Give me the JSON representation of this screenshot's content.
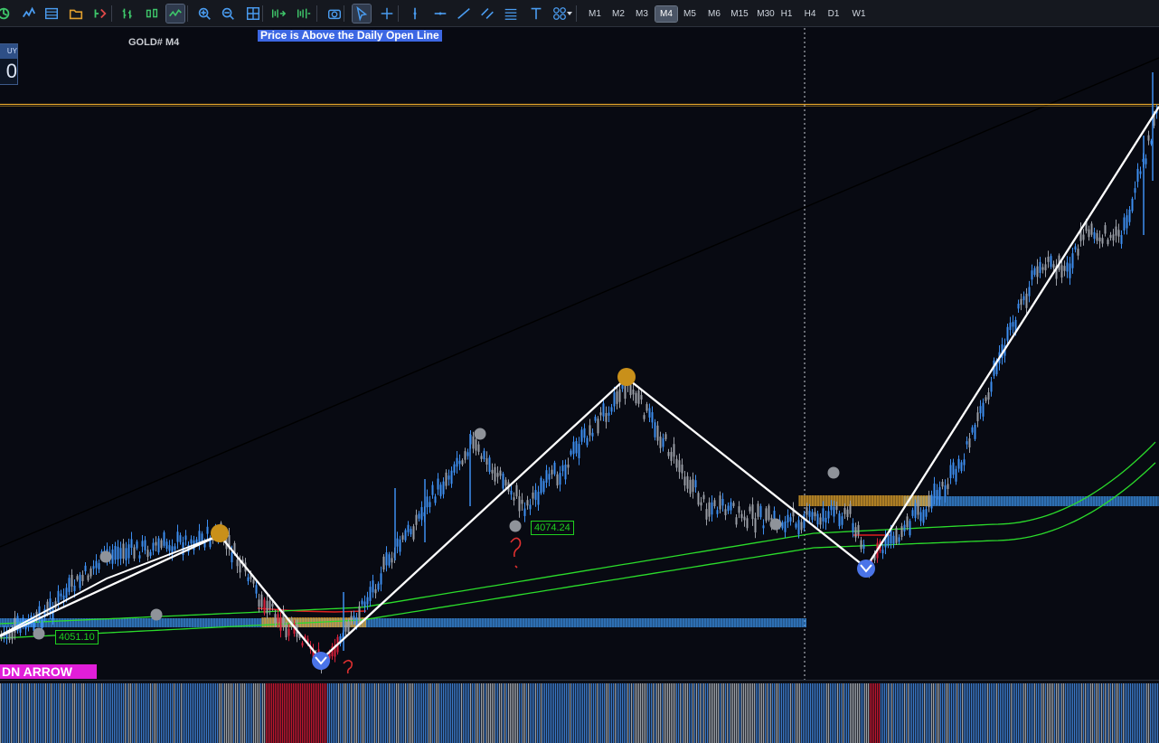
{
  "toolbar": {
    "tools": [
      {
        "name": "auto-trading-icon",
        "label": "Algo Trading"
      },
      {
        "name": "signals-icon",
        "label": "Signals"
      },
      {
        "name": "market-watch-icon",
        "label": "Market Watch"
      },
      {
        "name": "folder-icon",
        "label": "Data Folder"
      },
      {
        "name": "new-order-icon",
        "label": "New Order"
      },
      {
        "name": "bar-chart-icon",
        "label": "Bar Chart"
      },
      {
        "name": "candlestick-icon",
        "label": "Candlesticks"
      },
      {
        "name": "line-chart-icon",
        "label": "Line Chart"
      },
      {
        "name": "zoom-in-icon",
        "label": "Zoom In"
      },
      {
        "name": "zoom-out-icon",
        "label": "Zoom Out"
      },
      {
        "name": "grid-icon",
        "label": "Tile Windows"
      },
      {
        "name": "scroll-end-icon",
        "label": "Scroll to End"
      },
      {
        "name": "chart-shift-icon",
        "label": "Chart Shift"
      },
      {
        "name": "screenshot-icon",
        "label": "Screenshot"
      },
      {
        "name": "cursor-icon",
        "label": "Cursor"
      },
      {
        "name": "crosshair-icon",
        "label": "Crosshair"
      },
      {
        "name": "vertical-line-icon",
        "label": "Vertical Line"
      },
      {
        "name": "horizontal-line-icon",
        "label": "Horizontal Line"
      },
      {
        "name": "trendline-icon",
        "label": "Trend Line"
      },
      {
        "name": "channel-icon",
        "label": "Channels"
      },
      {
        "name": "fibonacci-icon",
        "label": "Fibonacci"
      },
      {
        "name": "text-icon",
        "label": "Text"
      },
      {
        "name": "shapes-icon",
        "label": "Shapes"
      }
    ],
    "timeframes": [
      "M1",
      "M2",
      "M3",
      "M4",
      "M5",
      "M6",
      "M15",
      "M30",
      "H1",
      "H4",
      "D1",
      "W1"
    ],
    "active_timeframe": "M4"
  },
  "chart": {
    "symbol_label": "GOLD# M4",
    "banner_text": "Price is Above the Daily Open Line",
    "buy_panel": {
      "title": "UY",
      "value": "0"
    },
    "signal_label": "DN ARROW",
    "price_labels": [
      "4074.24",
      "4051.10"
    ],
    "colors": {
      "background": "#080a12",
      "bull_candle": "#3d8ef0",
      "bear_candle": "#9a9ea6",
      "zigzag": "#ffffff",
      "ma_line": "#2bdc2b",
      "support_zone": "#3a8fe6",
      "daily_open_zone": "#e3a42a",
      "swing_high_marker": "#c9901a",
      "swing_low_marker": "#4a74e8",
      "histogram_bull": "#3a79c9",
      "histogram_bear": "#c0152e",
      "histogram_neutral": "#9aa0a8",
      "signal_label_bg": "#e11ed9"
    }
  }
}
